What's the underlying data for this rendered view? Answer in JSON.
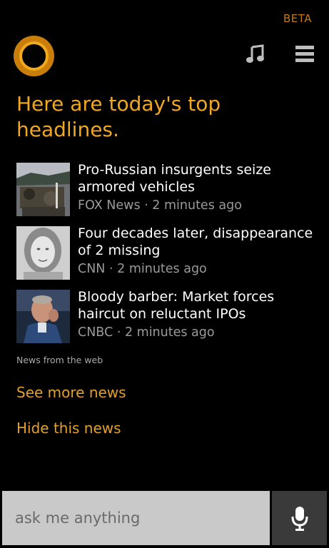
{
  "header": {
    "beta_label": "BETA"
  },
  "icons": {
    "cortana": "cortana-ring-icon",
    "music": "music-note-icon",
    "menu": "hamburger-menu-icon",
    "mic": "microphone-icon"
  },
  "colors": {
    "accent": "#f0a820",
    "link": "#e3a12b",
    "background": "#000000",
    "meta_text": "#9a9a9a",
    "search_bg": "#c9c9c9",
    "mic_bg": "#3a3a3a"
  },
  "main": {
    "headline": "Here are today's top headlines.",
    "news": [
      {
        "title": "Pro-Russian insurgents seize armored vehicles",
        "source": "FOX News",
        "time": "2 minutes ago"
      },
      {
        "title": "Four decades later, disappearance of 2 missing",
        "source": "CNN",
        "time": "2 minutes ago"
      },
      {
        "title": "Bloody barber: Market forces haircut on reluctant IPOs",
        "source": "CNBC",
        "time": "2 minutes ago"
      }
    ],
    "source_note": "News from the web",
    "see_more_label": "See more news",
    "hide_label": "Hide this news"
  },
  "search": {
    "placeholder": "ask me anything",
    "value": ""
  }
}
